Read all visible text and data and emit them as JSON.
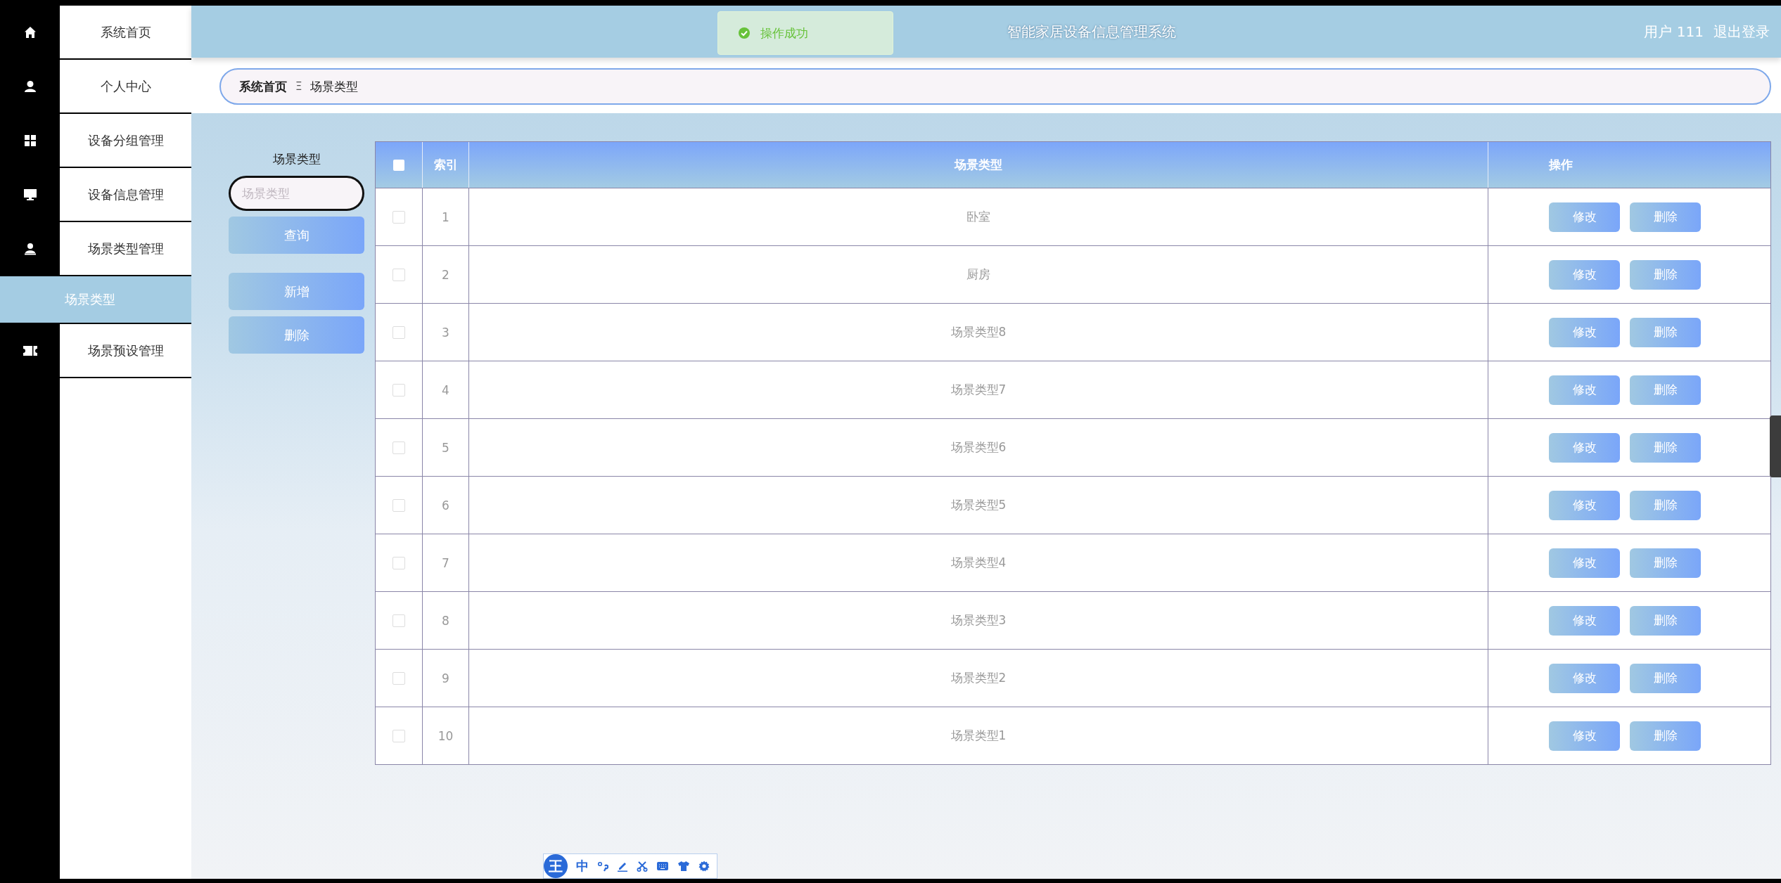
{
  "sidebar": {
    "items": [
      {
        "label": "系统首页",
        "selected": false
      },
      {
        "label": "个人中心",
        "selected": false
      },
      {
        "label": "设备分组管理",
        "selected": false
      },
      {
        "label": "设备信息管理",
        "selected": false
      },
      {
        "label": "场景类型管理",
        "selected": false,
        "children": [
          {
            "label": "场景类型",
            "selected": true
          }
        ]
      },
      {
        "label": "场景预设管理",
        "selected": false
      }
    ]
  },
  "header": {
    "title": "智能家居设备信息管理系统",
    "user": "用户 111",
    "logout": "退出登录"
  },
  "toast": {
    "message": "操作成功"
  },
  "breadcrumb": {
    "items": [
      "系统首页",
      "场景类型"
    ],
    "separator": "Ξ"
  },
  "search": {
    "label": "场景类型",
    "placeholder": "场景类型",
    "buttons": [
      "查询",
      "新增",
      "删除"
    ]
  },
  "table": {
    "columns": [
      "索引",
      "场景类型",
      "操作"
    ],
    "select_all": false,
    "rows": [
      {
        "index": "1",
        "name": "卧室",
        "checked": false,
        "actions": [
          "修改",
          "删除"
        ]
      },
      {
        "index": "2",
        "name": "厨房",
        "checked": false,
        "actions": [
          "修改",
          "删除"
        ]
      },
      {
        "index": "3",
        "name": "场景类型8",
        "checked": false,
        "actions": [
          "修改",
          "删除"
        ]
      },
      {
        "index": "4",
        "name": "场景类型7",
        "checked": false,
        "actions": [
          "修改",
          "删除"
        ]
      },
      {
        "index": "5",
        "name": "场景类型6",
        "checked": false,
        "actions": [
          "修改",
          "删除"
        ]
      },
      {
        "index": "6",
        "name": "场景类型5",
        "checked": false,
        "actions": [
          "修改",
          "删除"
        ]
      },
      {
        "index": "7",
        "name": "场景类型4",
        "checked": false,
        "actions": [
          "修改",
          "删除"
        ]
      },
      {
        "index": "8",
        "name": "场景类型3",
        "checked": false,
        "actions": [
          "修改",
          "删除"
        ]
      },
      {
        "index": "9",
        "name": "场景类型2",
        "checked": false,
        "actions": [
          "修改",
          "删除"
        ]
      },
      {
        "index": "10",
        "name": "场景类型1",
        "checked": false,
        "actions": [
          "修改",
          "删除"
        ]
      }
    ]
  },
  "ime_toolbar": {
    "logo": "王",
    "mode": "中"
  }
}
